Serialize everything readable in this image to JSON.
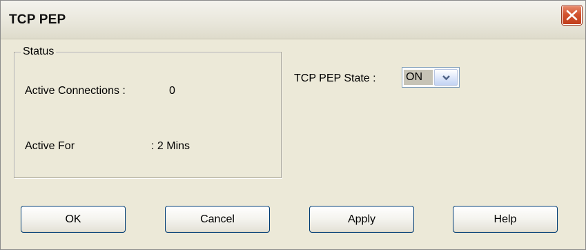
{
  "window": {
    "title": "TCP PEP"
  },
  "status": {
    "legend": "Status",
    "connections_label": "Active Connections :",
    "connections_value": "0",
    "active_for_label": "Active For",
    "active_for_value": ": 2 Mins"
  },
  "state": {
    "label": "TCP PEP State :",
    "value": "ON"
  },
  "buttons": {
    "ok": "OK",
    "cancel": "Cancel",
    "apply": "Apply",
    "help": "Help"
  },
  "colors": {
    "dialog_bg": "#ece9d8",
    "close_red": "#d2532f",
    "button_border": "#003c74"
  },
  "icons": {
    "close": "close-x-icon",
    "dropdown": "chevron-down-icon"
  }
}
